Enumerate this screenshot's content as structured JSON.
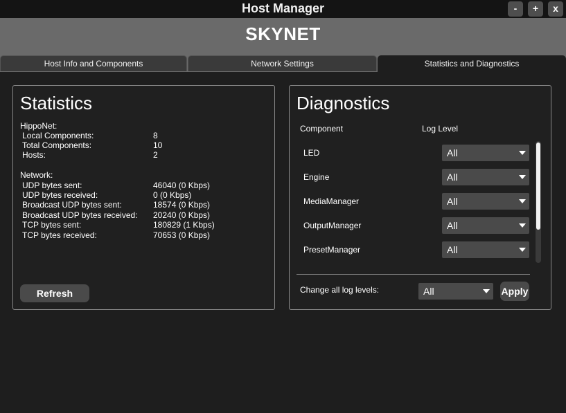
{
  "window": {
    "title": "Host Manager",
    "minimize_label": "-",
    "maximize_label": "+",
    "close_label": "x"
  },
  "host": {
    "name": "SKYNET"
  },
  "tabs": [
    {
      "label": "Host Info and Components",
      "active": false
    },
    {
      "label": "Network Settings",
      "active": false
    },
    {
      "label": "Statistics and Diagnostics",
      "active": true
    }
  ],
  "statistics": {
    "title": "Statistics",
    "hipponet_heading": "HippoNet:",
    "hipponet": [
      {
        "label": "Local Components:",
        "value": "8"
      },
      {
        "label": "Total Components:",
        "value": "10"
      },
      {
        "label": "Hosts:",
        "value": "2"
      }
    ],
    "network_heading": "Network:",
    "network": [
      {
        "label": "UDP bytes sent:",
        "value": "46040 (0 Kbps)"
      },
      {
        "label": "UDP bytes received:",
        "value": "0 (0 Kbps)"
      },
      {
        "label": "Broadcast UDP bytes sent:",
        "value": "18574 (0 Kbps)"
      },
      {
        "label": "Broadcast UDP bytes received:",
        "value": "20240 (0 Kbps)"
      },
      {
        "label": "TCP bytes sent:",
        "value": "180829 (1 Kbps)"
      },
      {
        "label": "TCP bytes received:",
        "value": "70653 (0 Kbps)"
      }
    ],
    "refresh_label": "Refresh"
  },
  "diagnostics": {
    "title": "Diagnostics",
    "column_component": "Component",
    "column_log_level": "Log Level",
    "components": [
      {
        "name": "LED",
        "level": "All"
      },
      {
        "name": "Engine",
        "level": "All"
      },
      {
        "name": "MediaManager",
        "level": "All"
      },
      {
        "name": "OutputManager",
        "level": "All"
      },
      {
        "name": "PresetManager",
        "level": "All"
      }
    ],
    "change_all_label": "Change all log levels:",
    "change_all_value": "All",
    "apply_label": "Apply"
  }
}
